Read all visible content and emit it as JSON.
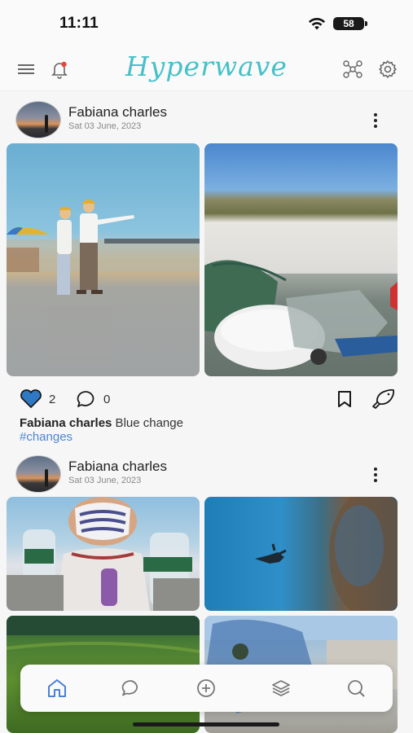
{
  "status_bar": {
    "time": "11:11",
    "battery": "58"
  },
  "header": {
    "title": "Hyperwave",
    "icons": [
      "menu-icon",
      "bell-icon",
      "network-icon",
      "settings-icon"
    ],
    "accent_color": "#45c1c8"
  },
  "posts": [
    {
      "author": "Fabiana charles",
      "date": "Sat 03 June, 2023",
      "photos": [
        "beach-men",
        "beach-trash"
      ],
      "likes": "2",
      "comments": "0",
      "caption_author": "Fabiana charles",
      "caption_text": " Blue change",
      "hashtag": "#changes"
    },
    {
      "author": "Fabiana charles",
      "date": "Sat 03 June, 2023",
      "photos": [
        "mask",
        "diver",
        "field",
        "bag"
      ]
    }
  ],
  "bottom_nav": {
    "items": [
      "home-icon",
      "chat-icon",
      "add-icon",
      "layers-icon",
      "search-icon"
    ],
    "active": "home-icon",
    "active_color": "#4d7fd6"
  },
  "colors": {
    "hashtag": "#4d86d2",
    "like_fill": "#2f79c4"
  }
}
